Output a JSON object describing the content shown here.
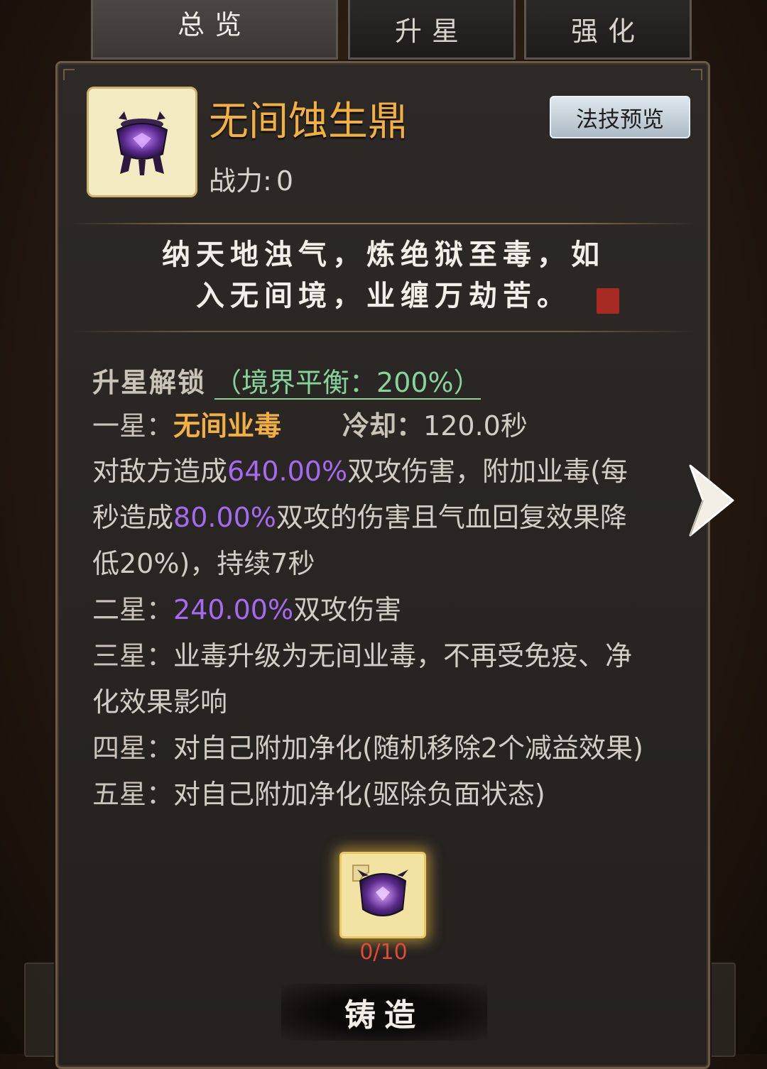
{
  "tabs": [
    {
      "label": "总览",
      "active": true
    },
    {
      "label": "升星",
      "active": false
    },
    {
      "label": "强化",
      "active": false
    }
  ],
  "item": {
    "name": "无间蚀生鼎",
    "power_label": "战力:",
    "power_value": "0",
    "icon": "purple-cauldron-icon"
  },
  "skill_preview_label": "法技预览",
  "poem": {
    "line1": "纳天地浊气，炼绝狱至毒，如",
    "line2": "入无间境，业缠万劫苦。"
  },
  "star_unlock": {
    "title": "升星解锁",
    "balance": "（境界平衡：200%）",
    "star1": {
      "label": "一星：",
      "skill_name": "无间业毒",
      "cooldown_label": "冷却：",
      "cooldown_value": "120.0秒",
      "desc_a": "对敌方造成",
      "desc_b": "640.00%",
      "desc_c": "双攻伤害，附加业毒(每",
      "desc_d": "秒造成",
      "desc_e": "80.00%",
      "desc_f": "双攻的伤害且气血回复效果降",
      "desc_g": "低20%)，持续7秒"
    },
    "star2": {
      "label": "二星：",
      "value": "240.00%",
      "text": "双攻伤害"
    },
    "star3": {
      "label": "三星：",
      "text1": "业毒升级为无间业毒，不再受免疫、净",
      "text2": "化效果影响"
    },
    "star4": {
      "label": "四星：",
      "text": "对自己附加净化(随机移除2个减益效果)"
    },
    "star5": {
      "label": "五星：",
      "text": "对自己附加净化(驱除负面状态)"
    }
  },
  "fragment": {
    "count": "0/10",
    "icon": "cauldron-fragment-icon"
  },
  "forge_label": "铸造",
  "colors": {
    "gold": "#f2b040",
    "purple": "#a46af0",
    "green": "#86d39e",
    "red": "#e04a3a"
  }
}
